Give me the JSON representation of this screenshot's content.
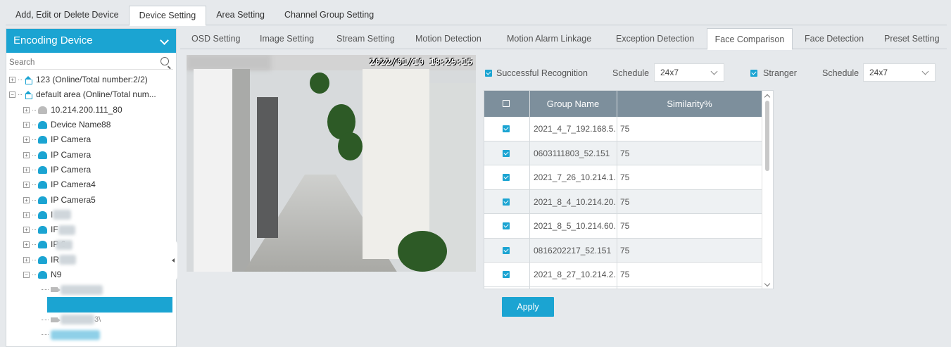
{
  "top_tabs": [
    {
      "label": "Add, Edit or Delete Device"
    },
    {
      "label": "Device Setting"
    },
    {
      "label": "Area Setting"
    },
    {
      "label": "Channel Group Setting"
    }
  ],
  "sidebar": {
    "title": "Encoding Device",
    "search_placeholder": "Search",
    "tree": [
      {
        "label": "123 (Online/Total number:2/2)",
        "level": 0,
        "expander": "+",
        "icon": "home-icon"
      },
      {
        "label": "default area (Online/Total num...",
        "level": 0,
        "expander": "-",
        "icon": "home-icon"
      },
      {
        "label": "10.214.200.111_80",
        "level": 1,
        "expander": "+",
        "icon": "device-offline-icon"
      },
      {
        "label": "Device Name88",
        "level": 1,
        "expander": "+",
        "icon": "device-icon"
      },
      {
        "label": "IP Camera",
        "level": 1,
        "expander": "+",
        "icon": "device-icon"
      },
      {
        "label": "IP Camera",
        "level": 1,
        "expander": "+",
        "icon": "device-icon"
      },
      {
        "label": "IP Camera",
        "level": 1,
        "expander": "+",
        "icon": "device-icon"
      },
      {
        "label": "IP Camera4",
        "level": 1,
        "expander": "+",
        "icon": "device-icon"
      },
      {
        "label": "IP Camera5",
        "level": 1,
        "expander": "+",
        "icon": "device-icon"
      },
      {
        "label": "I",
        "level": 1,
        "expander": "+",
        "icon": "device-icon"
      },
      {
        "label": "IF",
        "level": 1,
        "expander": "+",
        "icon": "device-icon"
      },
      {
        "label": "IP 6",
        "level": 1,
        "expander": "+",
        "icon": "device-icon"
      },
      {
        "label": "IR",
        "level": 1,
        "expander": "+",
        "icon": "device-icon"
      },
      {
        "label": "N9",
        "level": 1,
        "expander": "-",
        "icon": "device-icon"
      }
    ],
    "channel_suffix": "3\\"
  },
  "sub_tabs": [
    {
      "label": "OSD Setting"
    },
    {
      "label": "Image Setting"
    },
    {
      "label": "Stream Setting"
    },
    {
      "label": "Motion Detection"
    },
    {
      "label": "Motion Alarm Linkage"
    },
    {
      "label": "Exception Detection"
    },
    {
      "label": "Face Comparison"
    },
    {
      "label": "Face Detection"
    },
    {
      "label": "Preset Setting"
    }
  ],
  "video": {
    "osd_timestamp": "2022/01/10 18:29:15"
  },
  "options": {
    "successful_recognition": {
      "label": "Successful Recognition",
      "checked": true
    },
    "schedule_label_1": "Schedule",
    "schedule_value_1": "24x7",
    "stranger": {
      "label": "Stranger",
      "checked": true
    },
    "schedule_label_2": "Schedule",
    "schedule_value_2": "24x7"
  },
  "table": {
    "headers": {
      "group_name": "Group Name",
      "similarity": "Similarity%"
    },
    "rows": [
      {
        "group": "2021_4_7_192.168.5...",
        "similarity": "75",
        "checked": true
      },
      {
        "group": "0603111803_52.151",
        "similarity": "75",
        "checked": true
      },
      {
        "group": "2021_7_26_10.214.1...",
        "similarity": "75",
        "checked": true
      },
      {
        "group": "2021_8_4_10.214.20...",
        "similarity": "75",
        "checked": true
      },
      {
        "group": "2021_8_5_10.214.60....",
        "similarity": "75",
        "checked": true
      },
      {
        "group": "0816202217_52.151",
        "similarity": "75",
        "checked": true
      },
      {
        "group": "2021_8_27_10.214.2...",
        "similarity": "75",
        "checked": true
      }
    ]
  },
  "apply_label": "Apply",
  "colors": {
    "accent": "#1ba4d2",
    "table_header": "#7d8f9c",
    "background": "#e6e9ec"
  }
}
